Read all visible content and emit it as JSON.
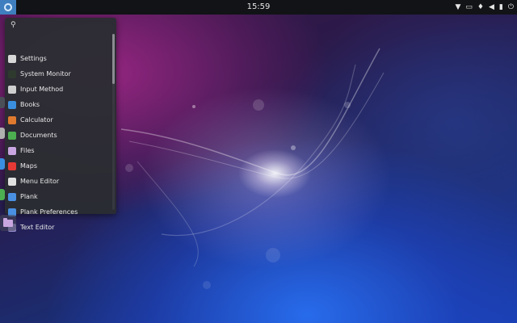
{
  "topbar": {
    "clock": "15:59",
    "indicators": [
      "wifi-icon",
      "notification-icon",
      "bluetooth-icon",
      "volume-icon",
      "battery-icon",
      "power-icon"
    ]
  },
  "launcher": {
    "search_placeholder": "",
    "apps": [
      {
        "label": "Settings",
        "icon": "settings-icon",
        "color": "#d8d8d8"
      },
      {
        "label": "System Monitor",
        "icon": "system-monitor-icon",
        "color": "#2f3a2f"
      },
      {
        "label": "Input Method",
        "icon": "input-method-icon",
        "color": "#cfcfcf"
      },
      {
        "label": "Books",
        "icon": "books-icon",
        "color": "#3b8fe0"
      },
      {
        "label": "Calculator",
        "icon": "calculator-icon",
        "color": "#e07a2f"
      },
      {
        "label": "Documents",
        "icon": "documents-icon",
        "color": "#4caf50"
      },
      {
        "label": "Files",
        "icon": "files-icon",
        "color": "#c9a6e0"
      },
      {
        "label": "Maps",
        "icon": "maps-icon",
        "color": "#e53935"
      },
      {
        "label": "Menu Editor",
        "icon": "menu-editor-icon",
        "color": "#e0e0e0"
      },
      {
        "label": "Plank",
        "icon": "plank-icon",
        "color": "#4a90e2"
      },
      {
        "label": "Plank Preferences",
        "icon": "plank-preferences-icon",
        "color": "#4a90e2"
      },
      {
        "label": "Text Editor",
        "icon": "text-editor-icon",
        "color": "#9a8fd0"
      }
    ]
  }
}
